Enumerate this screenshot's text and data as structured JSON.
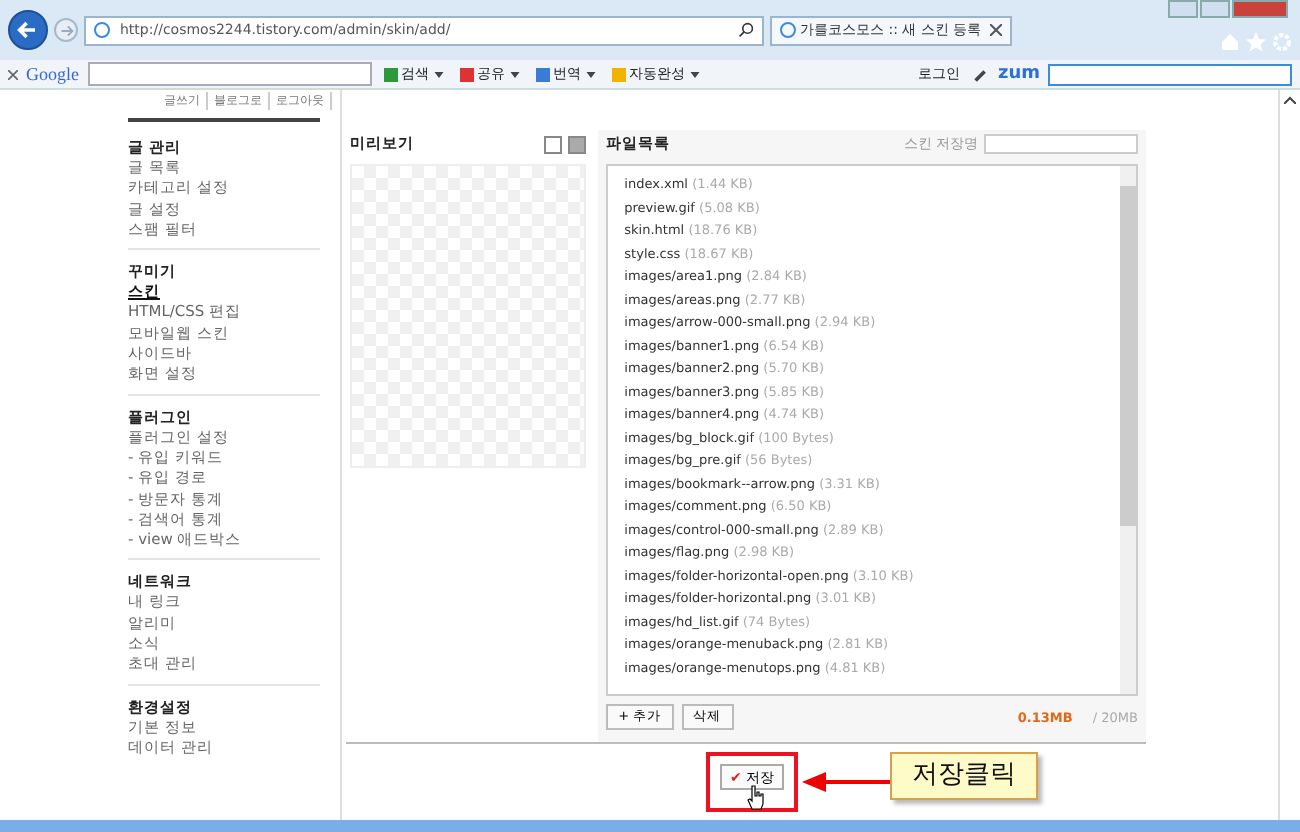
{
  "browser": {
    "address": "http://cosmos2244.tistory.com/admin/skin/add/",
    "tab_title": "가를코스모스 :: 새 스킨 등록"
  },
  "toolbar": {
    "google_logo": "Google",
    "items": [
      {
        "label": "검색",
        "kind": "search"
      },
      {
        "label": "공유",
        "kind": "share"
      },
      {
        "label": "번역",
        "kind": "translate"
      },
      {
        "label": "자동완성",
        "kind": "autofill"
      }
    ],
    "login": "로그인",
    "zum_logo": "zum"
  },
  "top_links": [
    "글쓰기",
    "블로그로",
    "로그아웃"
  ],
  "sidebar": [
    {
      "title": "글 관리",
      "items": [
        {
          "label": "글 목록",
          "selected": false
        },
        {
          "label": "카테고리 설정",
          "selected": false
        },
        {
          "label": "글 설정",
          "selected": false
        },
        {
          "label": "스팸 필터",
          "selected": false
        }
      ]
    },
    {
      "title": "꾸미기",
      "items": [
        {
          "label": "스킨",
          "selected": true
        },
        {
          "label": "HTML/CSS 편집",
          "selected": false
        },
        {
          "label": "모바일웹 스킨",
          "selected": false
        },
        {
          "label": "사이드바",
          "selected": false
        },
        {
          "label": "화면 설정",
          "selected": false
        }
      ]
    },
    {
      "title": "플러그인",
      "items": [
        {
          "label": "플러그인 설정",
          "selected": false
        },
        {
          "label": "- 유입 키워드",
          "selected": false
        },
        {
          "label": "- 유입 경로",
          "selected": false
        },
        {
          "label": "- 방문자 통계",
          "selected": false
        },
        {
          "label": "- 검색어 통계",
          "selected": false
        },
        {
          "label": "- view 애드박스",
          "selected": false
        }
      ]
    },
    {
      "title": "네트워크",
      "items": [
        {
          "label": "내 링크",
          "selected": false
        },
        {
          "label": "알리미",
          "selected": false
        },
        {
          "label": "소식",
          "selected": false
        },
        {
          "label": "초대 관리",
          "selected": false
        }
      ]
    },
    {
      "title": "환경설정",
      "items": [
        {
          "label": "기본 정보",
          "selected": false
        },
        {
          "label": "데이터 관리",
          "selected": false
        }
      ]
    }
  ],
  "preview": {
    "title": "미리보기"
  },
  "files": {
    "title": "파일목록",
    "name_label": "스킨 저장명",
    "list": [
      {
        "name": "index.xml",
        "size": "(1.44 KB)"
      },
      {
        "name": "preview.gif",
        "size": "(5.08 KB)"
      },
      {
        "name": "skin.html",
        "size": "(18.76 KB)"
      },
      {
        "name": "style.css",
        "size": "(18.67 KB)"
      },
      {
        "name": "images/area1.png",
        "size": "(2.84 KB)"
      },
      {
        "name": "images/areas.png",
        "size": "(2.77 KB)"
      },
      {
        "name": "images/arrow-000-small.png",
        "size": "(2.94 KB)"
      },
      {
        "name": "images/banner1.png",
        "size": "(6.54 KB)"
      },
      {
        "name": "images/banner2.png",
        "size": "(5.70 KB)"
      },
      {
        "name": "images/banner3.png",
        "size": "(5.85 KB)"
      },
      {
        "name": "images/banner4.png",
        "size": "(4.74 KB)"
      },
      {
        "name": "images/bg_block.gif",
        "size": "(100 Bytes)"
      },
      {
        "name": "images/bg_pre.gif",
        "size": "(56 Bytes)"
      },
      {
        "name": "images/bookmark--arrow.png",
        "size": "(3.31 KB)"
      },
      {
        "name": "images/comment.png",
        "size": "(6.50 KB)"
      },
      {
        "name": "images/control-000-small.png",
        "size": "(2.89 KB)"
      },
      {
        "name": "images/flag.png",
        "size": "(2.98 KB)"
      },
      {
        "name": "images/folder-horizontal-open.png",
        "size": "(3.10 KB)"
      },
      {
        "name": "images/folder-horizontal.png",
        "size": "(3.01 KB)"
      },
      {
        "name": "images/hd_list.gif",
        "size": "(74 Bytes)"
      },
      {
        "name": "images/orange-menuback.png",
        "size": "(2.81 KB)"
      },
      {
        "name": "images/orange-menutops.png",
        "size": "(4.81 KB)"
      }
    ],
    "add_button": "+ 추가",
    "delete_button": "삭제",
    "used": "0.13MB",
    "quota": "/ 20MB"
  },
  "save_button": {
    "check": "✔",
    "label": "저장"
  },
  "callout": "저장클릭"
}
